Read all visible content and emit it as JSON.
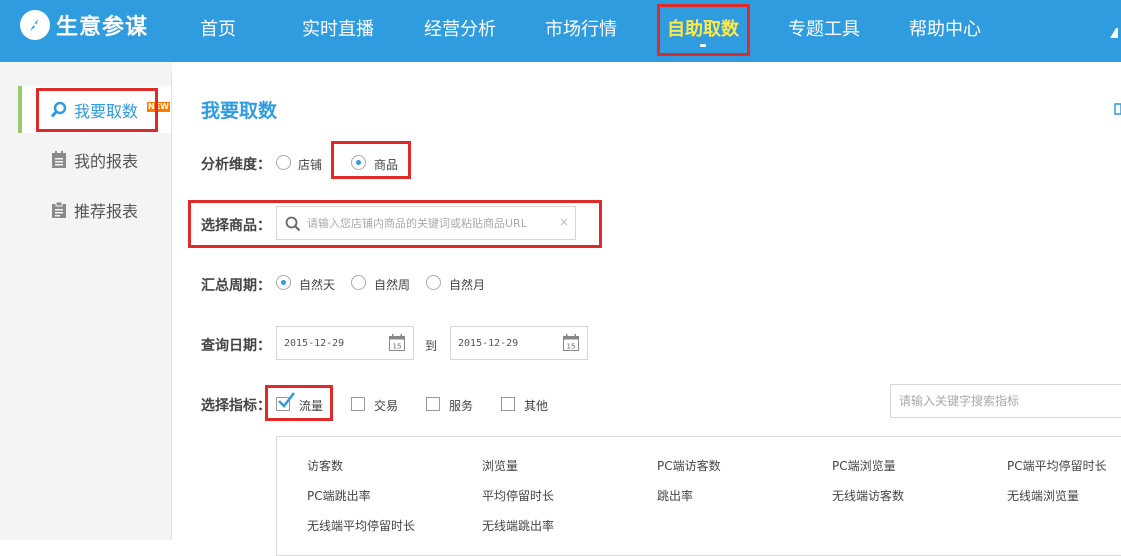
{
  "brand": {
    "name": "生意参谋"
  },
  "nav": {
    "items": [
      {
        "label": "首页"
      },
      {
        "label": "实时直播"
      },
      {
        "label": "经营分析"
      },
      {
        "label": "市场行情"
      },
      {
        "label": "自助取数"
      },
      {
        "label": "专题工具"
      },
      {
        "label": "帮助中心"
      }
    ],
    "active_index": 4
  },
  "sidebar": {
    "items": [
      {
        "label": "我要取数",
        "icon": "search-icon",
        "badge": "NEW"
      },
      {
        "label": "我的报表",
        "icon": "report-icon"
      },
      {
        "label": "推荐报表",
        "icon": "clipboard-icon"
      }
    ]
  },
  "main": {
    "title": "我要取数",
    "dimension": {
      "label": "分析维度：",
      "options": [
        {
          "label": "店铺"
        },
        {
          "label": "商品"
        }
      ],
      "selected": "商品"
    },
    "product": {
      "label": "选择商品：",
      "placeholder": "请输入您店铺内商品的关键词或粘贴商品URL",
      "clear": "×"
    },
    "period": {
      "label": "汇总周期：",
      "options": [
        {
          "label": "自然天"
        },
        {
          "label": "自然周"
        },
        {
          "label": "自然月"
        }
      ],
      "selected": "自然天"
    },
    "date": {
      "label": "查询日期：",
      "start": "2015-12-29",
      "separator": "到",
      "end": "2015-12-29",
      "calendar_day": "15"
    },
    "metrics": {
      "label": "选择指标：",
      "categories": [
        {
          "label": "流量",
          "checked": true
        },
        {
          "label": "交易",
          "checked": false
        },
        {
          "label": "服务",
          "checked": false
        },
        {
          "label": "其他",
          "checked": false
        }
      ],
      "search_placeholder": "请输入关键字搜索指标",
      "items": [
        "访客数",
        "浏览量",
        "PC端访客数",
        "PC端浏览量",
        "PC端平均停留时长",
        "PC端跳出率",
        "平均停留时长",
        "跳出率",
        "无线端访客数",
        "无线端浏览量",
        "无线端平均停留时长",
        "无线端跳出率"
      ]
    }
  },
  "colors": {
    "nav_bg": "#2f9ce0",
    "active_nav": "#ffe94a",
    "accent": "#2f9ce0",
    "highlight": "#e02a2a",
    "new_badge": "#ff7b00"
  }
}
